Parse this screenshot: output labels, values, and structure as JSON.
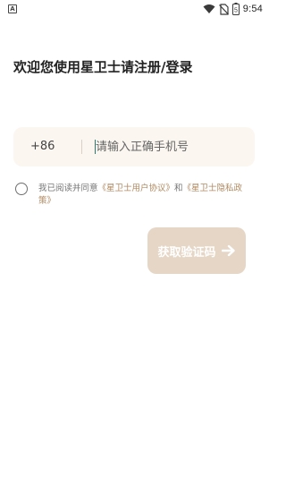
{
  "status_bar": {
    "notification_icon": "a-notification-icon",
    "time": "9:54",
    "battery_level": "5",
    "icons": [
      "wifi-icon",
      "no-sim-icon",
      "battery-icon"
    ]
  },
  "page": {
    "title": "欢迎您使用星卫士请注册/登录"
  },
  "phone_field": {
    "country_code": "+86",
    "value": "",
    "placeholder": "请输入正确手机号"
  },
  "agreement": {
    "checked": false,
    "prefix": "我已阅读并同意",
    "user_agreement": "《星卫士用户协议》",
    "conjunction": "和",
    "privacy_policy": "《星卫士隐私政策》"
  },
  "get_code_button": {
    "label": "获取验证码",
    "icon": "arrow-right-icon"
  },
  "colors": {
    "input_bg": "#fbf6f0",
    "button_disabled_bg": "#e6d6c6",
    "link": "#b08a61",
    "caret": "#2b7a6f"
  }
}
